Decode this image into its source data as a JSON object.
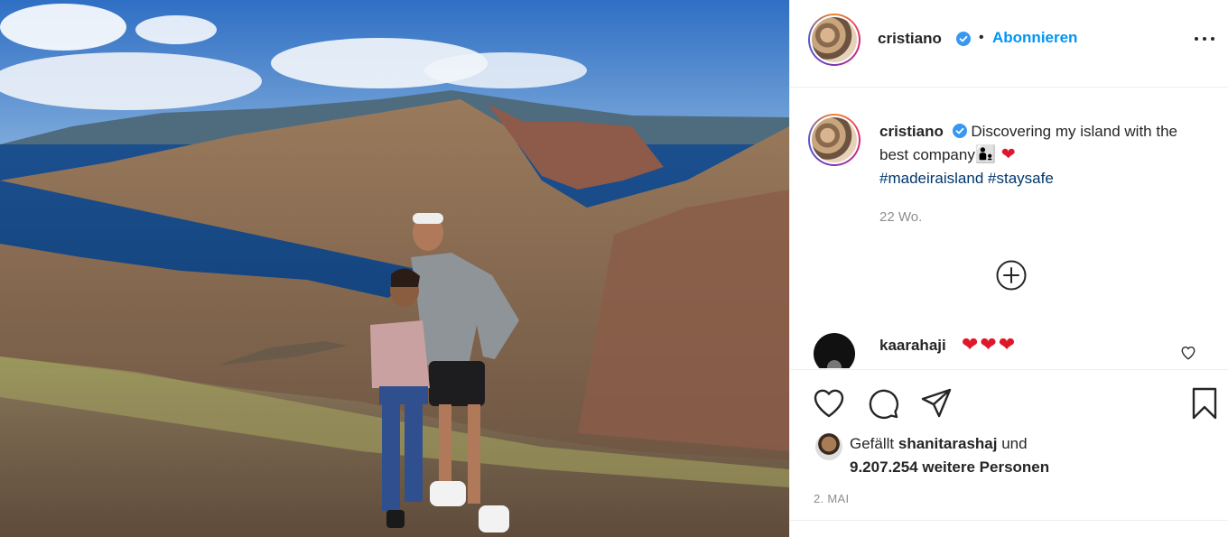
{
  "post": {
    "image_alt": "",
    "author": {
      "username": "cristiano",
      "verified": true,
      "follow_label": "Abonnieren",
      "separator": "•"
    },
    "caption": {
      "username": "cristiano",
      "text": "Discovering my island with the best company",
      "emoji": "👨‍👦 ❤",
      "hashtags": [
        "#madeiraisland",
        "#staysafe"
      ],
      "time": "22 Wo."
    },
    "comment": {
      "username": "kaarahaji",
      "text": "❤❤❤"
    },
    "likes": {
      "prefix": "Gefällt",
      "liked_by": "shanitarashaj",
      "conjunction": "und",
      "count_text": "9.207.254 weitere Personen"
    },
    "date": "2. MAI"
  },
  "icons": {
    "more": "more-options-icon",
    "verified": "verified-badge-icon",
    "load_more": "plus-circle-icon",
    "like": "heart-icon",
    "comment": "comment-icon",
    "share": "share-icon",
    "save": "bookmark-icon",
    "comment_like": "small-heart-icon"
  },
  "colors": {
    "accent": "#0095f6",
    "hashtag": "#00376b",
    "heart": "#e0172a",
    "muted": "#8e8e8e",
    "text": "#262626"
  }
}
